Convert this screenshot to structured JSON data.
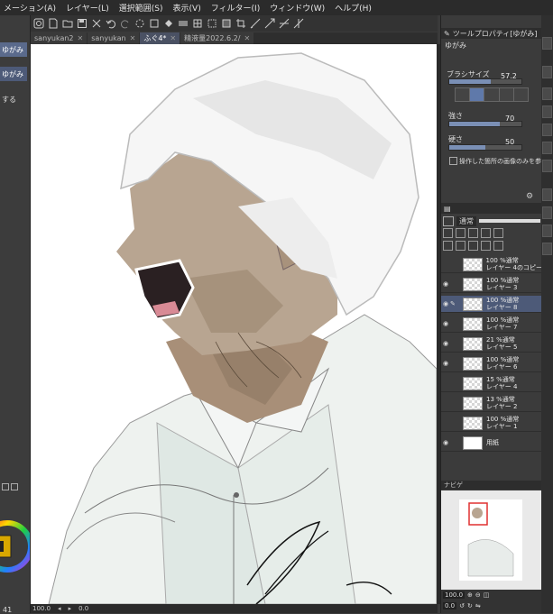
{
  "menu": [
    "メーション(A)",
    "レイヤー(L)",
    "選択範囲(S)",
    "表示(V)",
    "フィルター(I)",
    "ウィンドウ(W)",
    "ヘルプ(H)"
  ],
  "tabs": [
    {
      "label": "sanyukan2",
      "active": false
    },
    {
      "label": "sanyukan",
      "active": false
    },
    {
      "label": "ふぐ4*",
      "active": true
    },
    {
      "label": "精液量2022.6.2/",
      "active": false
    }
  ],
  "left_panel": {
    "item1": "ゆがみ",
    "item2": "ゆがみ",
    "item3": "する"
  },
  "tool_property": {
    "title": "ツールプロパティ[ゆがみ]",
    "subtool": "ゆがみ",
    "brush_size_label": "ブラシサイズ",
    "brush_size_value": "57.2",
    "strength_label": "強さ",
    "strength_value": "70",
    "hardness_label": "硬さ",
    "hardness_value": "50",
    "ref_label": "操作した箇所の画像のみを参照",
    "brush_size_frac": 0.57,
    "strength_frac": 0.7,
    "hardness_frac": 0.5
  },
  "layers": {
    "blend_mode": "通常",
    "items": [
      {
        "opacity": "100 %通常",
        "name": "レイヤー 4のコピー",
        "selected": false,
        "visible": false
      },
      {
        "opacity": "100 %通常",
        "name": "レイヤー 3",
        "selected": false,
        "visible": true
      },
      {
        "opacity": "100 %通常",
        "name": "レイヤー 8",
        "selected": true,
        "visible": true
      },
      {
        "opacity": "100 %通常",
        "name": "レイヤー 7",
        "selected": false,
        "visible": true
      },
      {
        "opacity": "21 %通常",
        "name": "レイヤー 5",
        "selected": false,
        "visible": true
      },
      {
        "opacity": "100 %通常",
        "name": "レイヤー 6",
        "selected": false,
        "visible": true
      },
      {
        "opacity": "15 %通常",
        "name": "レイヤー 4",
        "selected": false,
        "visible": false
      },
      {
        "opacity": "13 %通常",
        "name": "レイヤー 2",
        "selected": false,
        "visible": false
      },
      {
        "opacity": "100 %通常",
        "name": "レイヤー 1",
        "selected": false,
        "visible": false
      },
      {
        "opacity": "",
        "name": "用紙",
        "selected": false,
        "visible": true
      }
    ]
  },
  "navigator": {
    "label": "ナビゲ",
    "zoom": "100.0",
    "rotation": "0.0"
  },
  "status": {
    "zoom": "100.0",
    "rotation": "0.0"
  },
  "left_bottom_value": "41"
}
